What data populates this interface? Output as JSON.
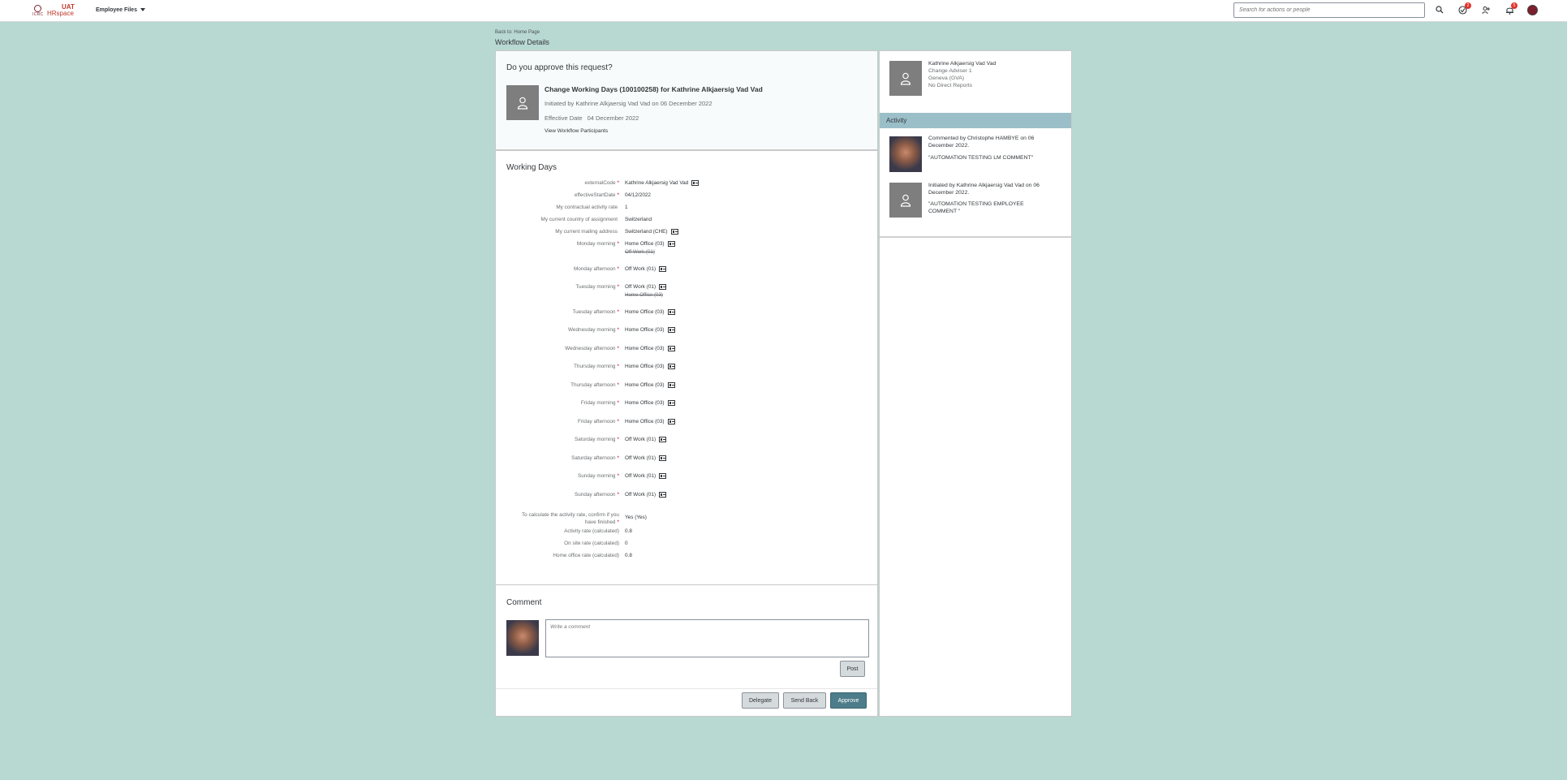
{
  "header": {
    "logo_org": "ICRC",
    "logo_env": "UAT",
    "logo_app": "HRspace",
    "menu_label": "Employee Files",
    "search_placeholder": "Search for actions or people",
    "badges": {
      "approvals": "2",
      "notifications": "5"
    }
  },
  "page": {
    "back_link": "Back to: Home Page",
    "title": "Workflow Details"
  },
  "request": {
    "question": "Do you approve this request?",
    "title": "Change Working Days (100100258) for Kathrine Alkjaersig Vad Vad",
    "initiated": "Initiated by Kathrine Alkjaersig Vad Vad on 06 December 2022",
    "effective_label": "Effective Date",
    "effective_value": "04 December 2022",
    "participants_link": "View Workflow Participants"
  },
  "working_days": {
    "title": "Working Days",
    "fields": [
      {
        "label": "externalCode",
        "required": "*",
        "value": "Kathrine Alkjaersig Vad Vad",
        "old": ""
      },
      {
        "label": "effectiveStartDate",
        "required": "*",
        "value": "04/12/2022",
        "old": ""
      },
      {
        "label": "My contractual activity rate",
        "required": "",
        "value": "1",
        "old": ""
      },
      {
        "label": "My current country of assignment",
        "required": "",
        "value": "Switzerland",
        "old": ""
      },
      {
        "label": "My current mailing address",
        "required": "",
        "value": "Switzerland (CHE)",
        "old": ""
      },
      {
        "label": "Monday morning",
        "required": "*",
        "value": "Home Office (03)",
        "old": "Off Work (01)"
      },
      {
        "label": "Monday afternoon",
        "required": "*",
        "value": "Off Work (01)",
        "old": ""
      },
      {
        "label": "Tuesday morning",
        "required": "*",
        "value": "Off Work (01)",
        "old": "Home Office (03)"
      },
      {
        "label": "Tuesday afternoon",
        "required": "*",
        "value": "Home Office (03)",
        "old": ""
      },
      {
        "label": "Wednesday morning",
        "required": "*",
        "value": "Home Office (03)",
        "old": ""
      },
      {
        "label": "Wednesday afternoon",
        "required": "*",
        "value": "Home Office (03)",
        "old": ""
      },
      {
        "label": "Thursday morning",
        "required": "*",
        "value": "Home Office (03)",
        "old": ""
      },
      {
        "label": "Thursday afternoon",
        "required": "*",
        "value": "Home Office (03)",
        "old": ""
      },
      {
        "label": "Friday morning",
        "required": "*",
        "value": "Home Office (03)",
        "old": ""
      },
      {
        "label": "Friday afternoon",
        "required": "*",
        "value": "Home Office (03)",
        "old": ""
      },
      {
        "label": "Saturday morning",
        "required": "*",
        "value": "Off Work (01)",
        "old": ""
      },
      {
        "label": "Saturday afternoon",
        "required": "*",
        "value": "Off Work (01)",
        "old": ""
      },
      {
        "label": "Sunday morning",
        "required": "*",
        "value": "Off Work (01)",
        "old": ""
      },
      {
        "label": "Sunday afternoon",
        "required": "*",
        "value": "Off Work (01)",
        "old": ""
      }
    ],
    "confirm_label_1": "To calculate the activity rate, confirm if you",
    "confirm_label_2": "have finished",
    "confirm_required": "*",
    "confirm_value": "Yes (Yes)",
    "calc": [
      {
        "label": "Activity rate (calculated)",
        "value": "0.8"
      },
      {
        "label": "On site rate (calculated)",
        "value": "0"
      },
      {
        "label": "Home office rate (calculated)",
        "value": "0.8"
      }
    ]
  },
  "comment": {
    "title": "Comment",
    "placeholder": "Write a comment",
    "post_label": "Post",
    "delegate_label": "Delegate",
    "send_back_label": "Send Back",
    "approve_label": "Approve"
  },
  "subject": {
    "name": "Kathrine Alkjaersig Vad Vad",
    "position": "Change Adviser 1",
    "location": "Geneva (GVA)",
    "reports": "No Direct Reports"
  },
  "activity": {
    "title": "Activity",
    "items": [
      {
        "line1": "Commented by Christophe HAMBYE on 06",
        "line2": "December 2022.",
        "quote": "\"AUTOMATION TESTING LM COMMENT\""
      },
      {
        "line1": "Initiated by Kathrine Alkjaersig Vad Vad on 06",
        "line2": "December 2022.",
        "quote1": "\"AUTOMATION TESTING EMPLOYEE",
        "quote2": "COMMENT \""
      }
    ]
  }
}
